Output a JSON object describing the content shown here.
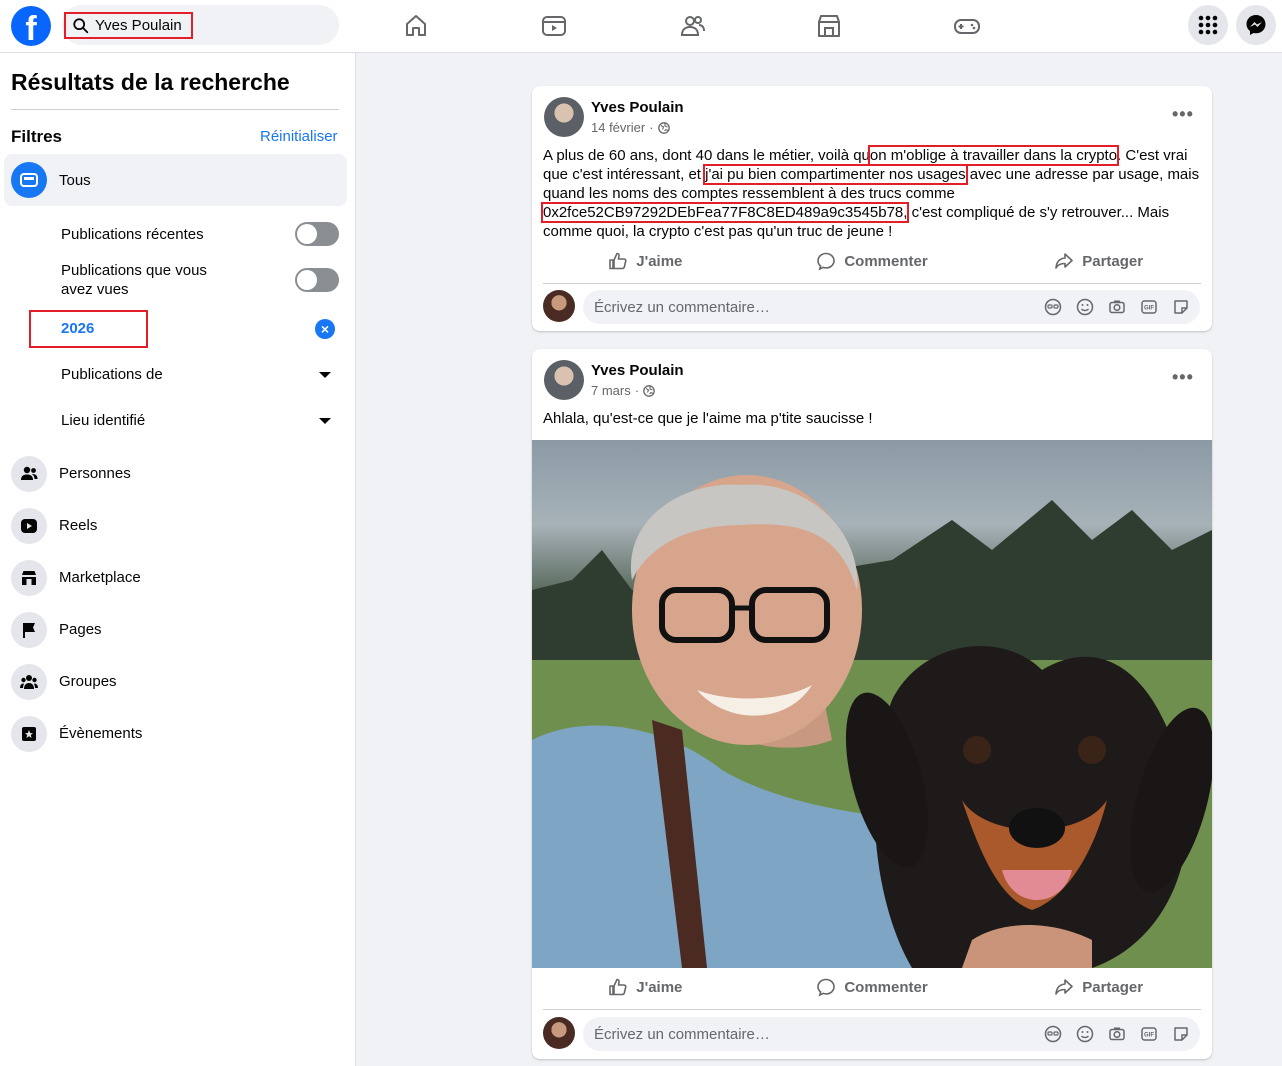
{
  "header": {
    "logo": "f",
    "search_value": "Yves Poulain",
    "nav_icons": [
      "home-icon",
      "video-icon",
      "friends-icon",
      "marketplace-icon",
      "gaming-icon"
    ],
    "right_icons": [
      "menu-grid-icon",
      "messenger-icon"
    ]
  },
  "sidebar": {
    "title": "Résultats de la recherche",
    "filters_label": "Filtres",
    "reset_label": "Réinitialiser",
    "all_label": "Tous",
    "sub_filters": {
      "recent": "Publications récentes",
      "seen_line1": "Publications que vous",
      "seen_line2": "avez vues",
      "year": "2026",
      "posts_from": "Publications de",
      "tagged_location": "Lieu identifié"
    },
    "categories": [
      {
        "label": "Personnes",
        "icon": "people-icon"
      },
      {
        "label": "Reels",
        "icon": "reels-icon"
      },
      {
        "label": "Marketplace",
        "icon": "marketplace-icon"
      },
      {
        "label": "Pages",
        "icon": "flag-icon"
      },
      {
        "label": "Groupes",
        "icon": "groups-icon"
      },
      {
        "label": "Évènements",
        "icon": "events-icon"
      }
    ]
  },
  "posts": [
    {
      "author": "Yves Poulain",
      "date": "14 février",
      "text_1": "A plus de 60 ans, dont 40 dans le métier, voilà qu",
      "text_hl1": "on m'oblige à travailler dans la crypto",
      "text_2": ". C'est vrai que c'est intéressant, et ",
      "text_hl2": "j'ai pu bien compartimenter nos usages",
      "text_3": " avec une adresse par usage, mais quand les noms des comptes ressemblent à des trucs comme ",
      "text_hl3": "0x2fce52CB97292DEbFea77F8C8ED489a9c3545b78,",
      "text_4": " c'est compliqué de s'y retrouver... Mais comme quoi, la crypto c'est pas qu'un truc de jeune !",
      "like": "J'aime",
      "comment": "Commenter",
      "share": "Partager",
      "comment_placeholder": "Écrivez un commentaire…"
    },
    {
      "author": "Yves Poulain",
      "date": "7 mars",
      "text": "Ahlala, qu'est-ce que je l'aime ma p'tite saucisse !",
      "like": "J'aime",
      "comment": "Commenter",
      "share": "Partager",
      "comment_placeholder": "Écrivez un commentaire…"
    }
  ],
  "colors": {
    "accent": "#1877f2",
    "highlight_box": "#e41e26",
    "background": "#f0f2f5"
  }
}
